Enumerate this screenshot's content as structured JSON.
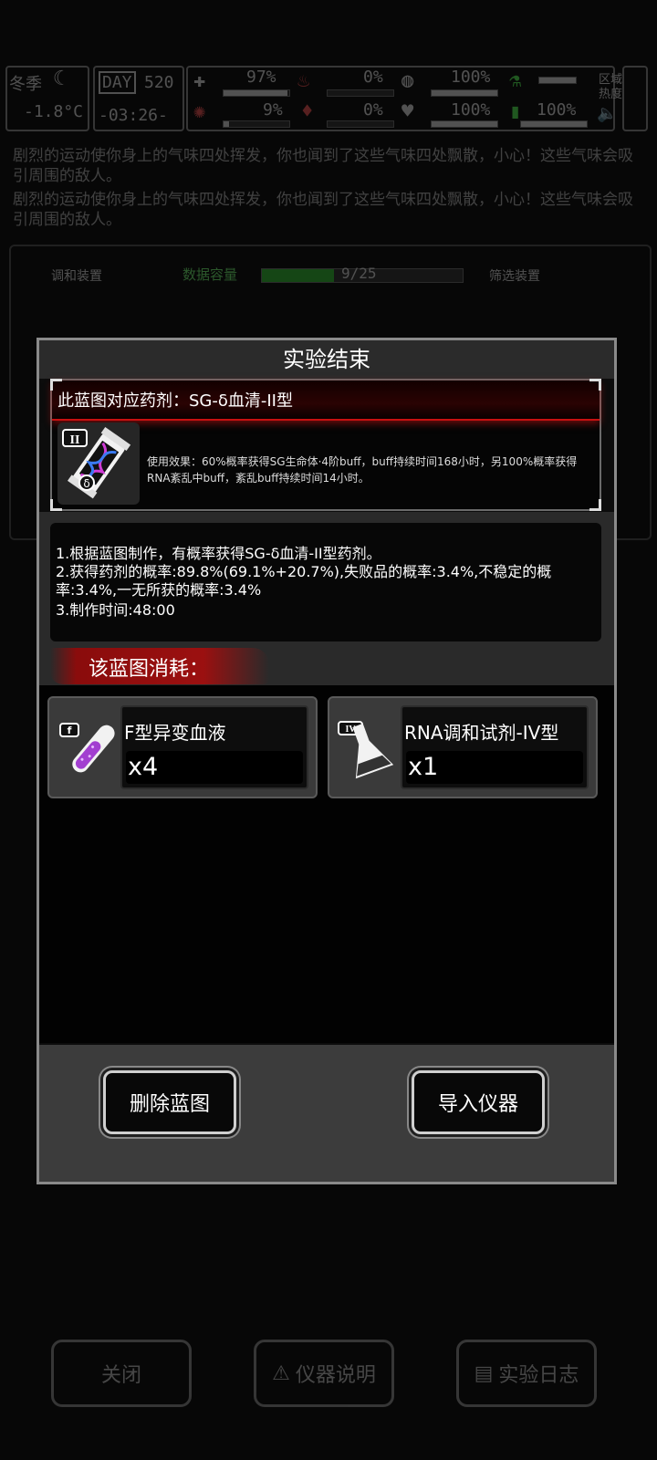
{
  "hud": {
    "season": "冬季",
    "temperature": "-1.8°C",
    "day_label": "DAY",
    "day_number": "520",
    "clock": "-03:26-",
    "stats": [
      {
        "icon": "medkit-icon",
        "value": "97%",
        "level": 0.97
      },
      {
        "icon": "hunger-icon",
        "value": "0%",
        "level": 0.0
      },
      {
        "icon": "stomach-icon",
        "value": "100%",
        "level": 1.0
      },
      {
        "icon": "flask-flag-icon",
        "value": "",
        "level": 1.0
      },
      {
        "icon": "brain-icon",
        "value": "9%",
        "level": 0.09
      },
      {
        "icon": "blood-drop-icon",
        "value": "0%",
        "level": 0.0
      },
      {
        "icon": "heart-icon",
        "value": "100%",
        "level": 1.0
      },
      {
        "icon": "battery-icon",
        "value": "100%",
        "level": 1.0
      }
    ],
    "area_heat_label": "区域热度"
  },
  "messages": [
    "剧烈的运动使你身上的气味四处挥发，你也闻到了这些气味四处飘散，小心！这些气味会吸引周围的敌人。",
    "剧烈的运动使你身上的气味四处挥发，你也闻到了这些气味四处飘散，小心！这些气味会吸引周围的敌人。"
  ],
  "lab_bg": {
    "left_device_label": "调和装置",
    "data_capacity_label": "数据容量",
    "data_capacity_value": "9/25",
    "data_capacity_level": 0.36,
    "right_device_label": "筛选装置"
  },
  "dialog": {
    "title": "实验结束",
    "blueprint_name": "此蓝图对应药剂：SG-δ血清-II型",
    "blueprint_icon_tier": "II",
    "effect_text": "使用效果：60%概率获得SG生命体·4阶buff，buff持续时间168小时，另100%概率获得RNA紊乱中buff，紊乱buff持续时间14小时。",
    "info_lines": [
      "1.根据蓝图制作，有概率获得SG-δ血清-II型药剂。",
      "2.获得药剂的概率:89.8%(69.1%+20.7%),失败品的概率:3.4%,不稳定的概",
      "率:3.4%,一无所获的概率:3.4%",
      "3.制作时间:48:00"
    ],
    "cost_label": "该蓝图消耗：",
    "materials": [
      {
        "name": "F型异变血液",
        "qty": "x4",
        "tier": "f",
        "icon": "test-tube-icon"
      },
      {
        "name": "RNA调和试剂-IV型",
        "qty": "x1",
        "tier": "IV",
        "icon": "flask-icon"
      }
    ],
    "delete_button": "删除蓝图",
    "import_button": "导入仪器"
  },
  "bottom_bar": {
    "close": "关闭",
    "instrument_help": "仪器说明",
    "lab_log": "实验日志"
  }
}
